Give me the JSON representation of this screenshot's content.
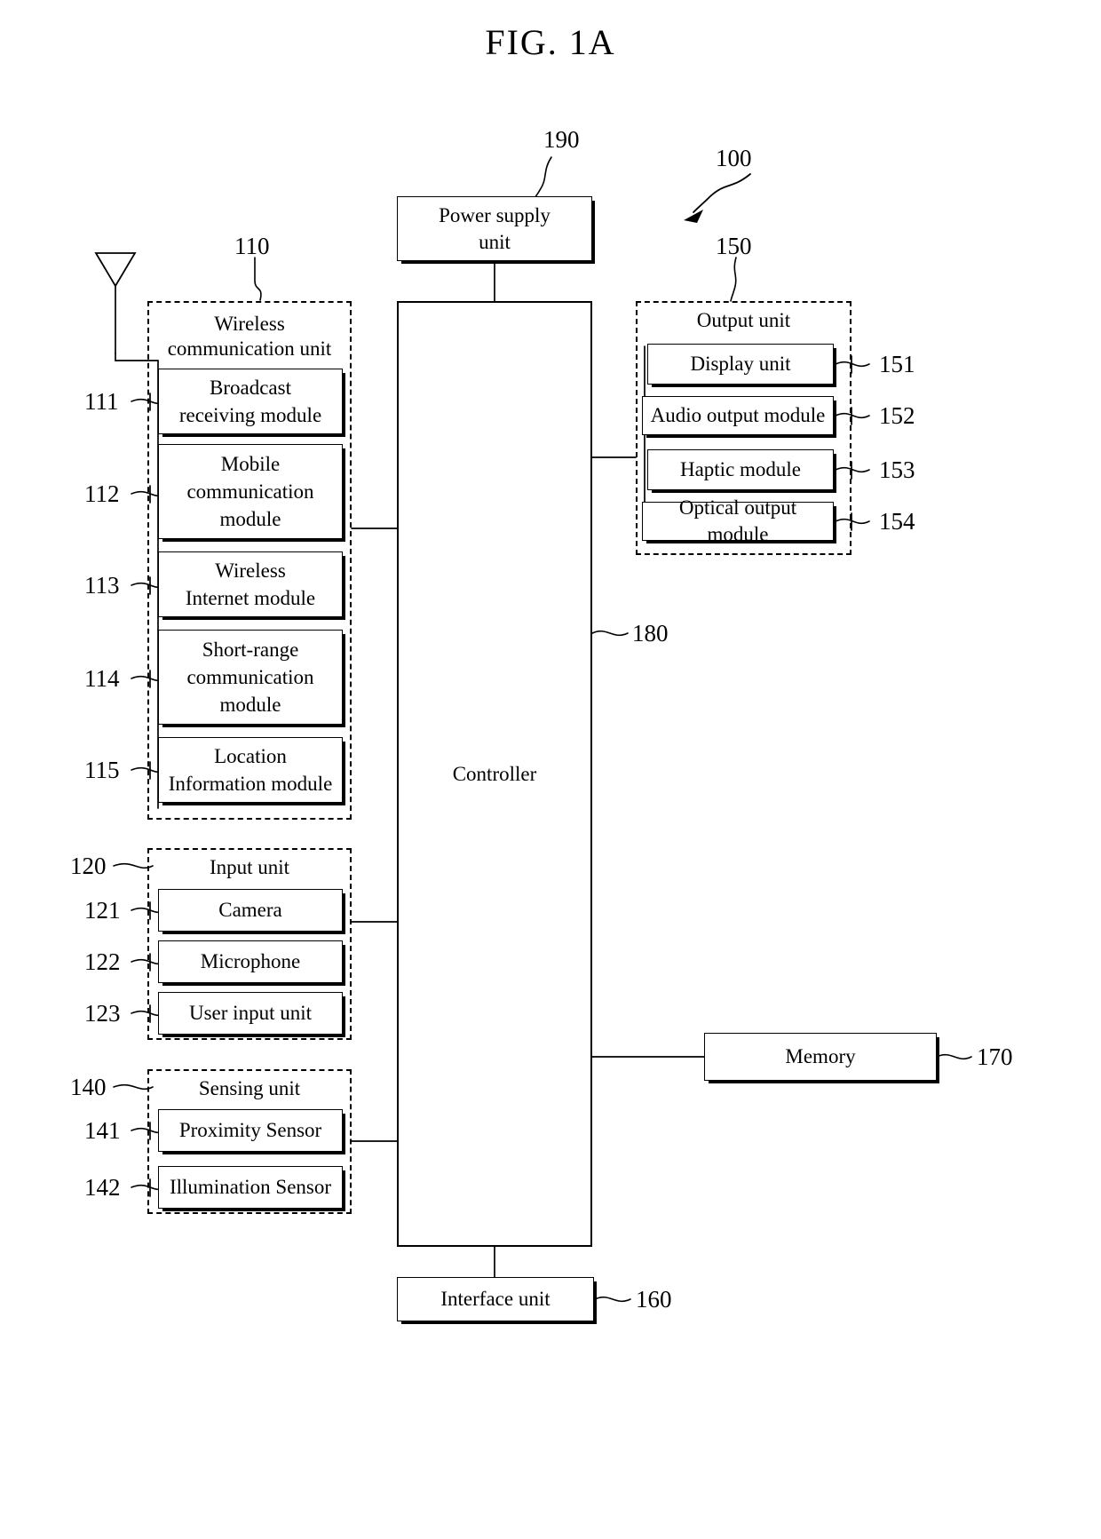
{
  "figure": {
    "title": "FIG. 1A",
    "device_ref": "100"
  },
  "blocks": {
    "power_supply": {
      "label": "Power supply\nunit",
      "ref": "190"
    },
    "controller": {
      "label": "Controller",
      "ref": "180"
    },
    "memory": {
      "label": "Memory",
      "ref": "170"
    },
    "interface": {
      "label": "Interface unit",
      "ref": "160"
    }
  },
  "groups": [
    {
      "name": "wireless_communication_unit",
      "title": "Wireless\ncommunication unit",
      "ref": "110",
      "modules": [
        {
          "label": "Broadcast\nreceiving module",
          "ref": "111"
        },
        {
          "label": "Mobile\ncommunication\nmodule",
          "ref": "112"
        },
        {
          "label": "Wireless\nInternet module",
          "ref": "113"
        },
        {
          "label": "Short-range\ncommunication\nmodule",
          "ref": "114"
        },
        {
          "label": "Location\nInformation module",
          "ref": "115"
        }
      ]
    },
    {
      "name": "input_unit",
      "title": "Input unit",
      "ref": "120",
      "modules": [
        {
          "label": "Camera",
          "ref": "121"
        },
        {
          "label": "Microphone",
          "ref": "122"
        },
        {
          "label": "User input unit",
          "ref": "123"
        }
      ]
    },
    {
      "name": "sensing_unit",
      "title": "Sensing unit",
      "ref": "140",
      "modules": [
        {
          "label": "Proximity Sensor",
          "ref": "141"
        },
        {
          "label": "Illumination Sensor",
          "ref": "142"
        }
      ]
    },
    {
      "name": "output_unit",
      "title": "Output unit",
      "ref": "150",
      "modules": [
        {
          "label": "Display unit",
          "ref": "151"
        },
        {
          "label": "Audio output module",
          "ref": "152"
        },
        {
          "label": "Haptic module",
          "ref": "153"
        },
        {
          "label": "Optical output module",
          "ref": "154"
        }
      ]
    }
  ],
  "icons": {
    "antenna": "antenna-icon",
    "device_arrow": "arrow-icon"
  },
  "colors": {
    "ink": "#000000",
    "paper": "#ffffff"
  }
}
